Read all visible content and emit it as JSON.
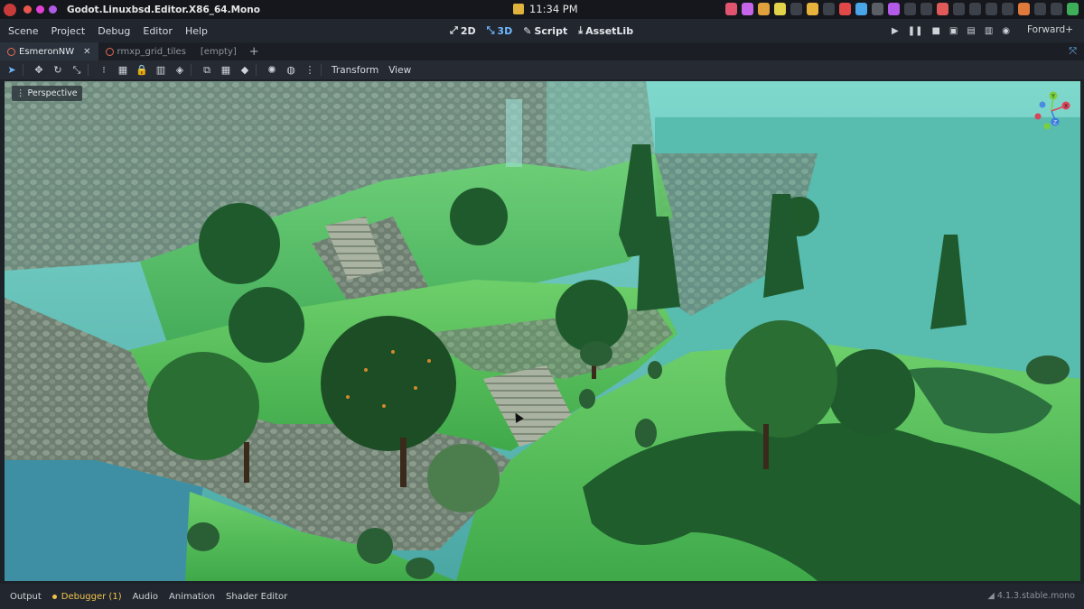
{
  "system_bar": {
    "window_title": "Godot.Linuxbsd.Editor.X86_64.Mono",
    "clock": "11:34 PM"
  },
  "menu": {
    "items": [
      "Scene",
      "Project",
      "Debug",
      "Editor",
      "Help"
    ],
    "main_screens": [
      {
        "label": "2D",
        "icon": "2d-icon"
      },
      {
        "label": "3D",
        "icon": "3d-icon"
      },
      {
        "label": "Script",
        "icon": "script-icon"
      },
      {
        "label": "AssetLib",
        "icon": "assetlib-icon"
      }
    ],
    "renderer": "Forward+"
  },
  "tabs": [
    {
      "label": "EsmeronNW",
      "active": true
    },
    {
      "label": "rmxp_grid_tiles",
      "active": false
    },
    {
      "label": "[empty]",
      "active": false
    }
  ],
  "toolbar": {
    "transform_menu": "Transform",
    "view_menu": "View"
  },
  "viewport": {
    "perspective_label": "Perspective",
    "gizmo_axes": [
      "Y",
      "X",
      "Z"
    ]
  },
  "bottom_panel": {
    "tabs": [
      "Output",
      "Debugger (1)",
      "Audio",
      "Animation",
      "Shader Editor"
    ],
    "version": "4.1.3.stable.mono"
  },
  "colors": {
    "accent": "#6fb8ff",
    "warning": "#f0c24a"
  }
}
